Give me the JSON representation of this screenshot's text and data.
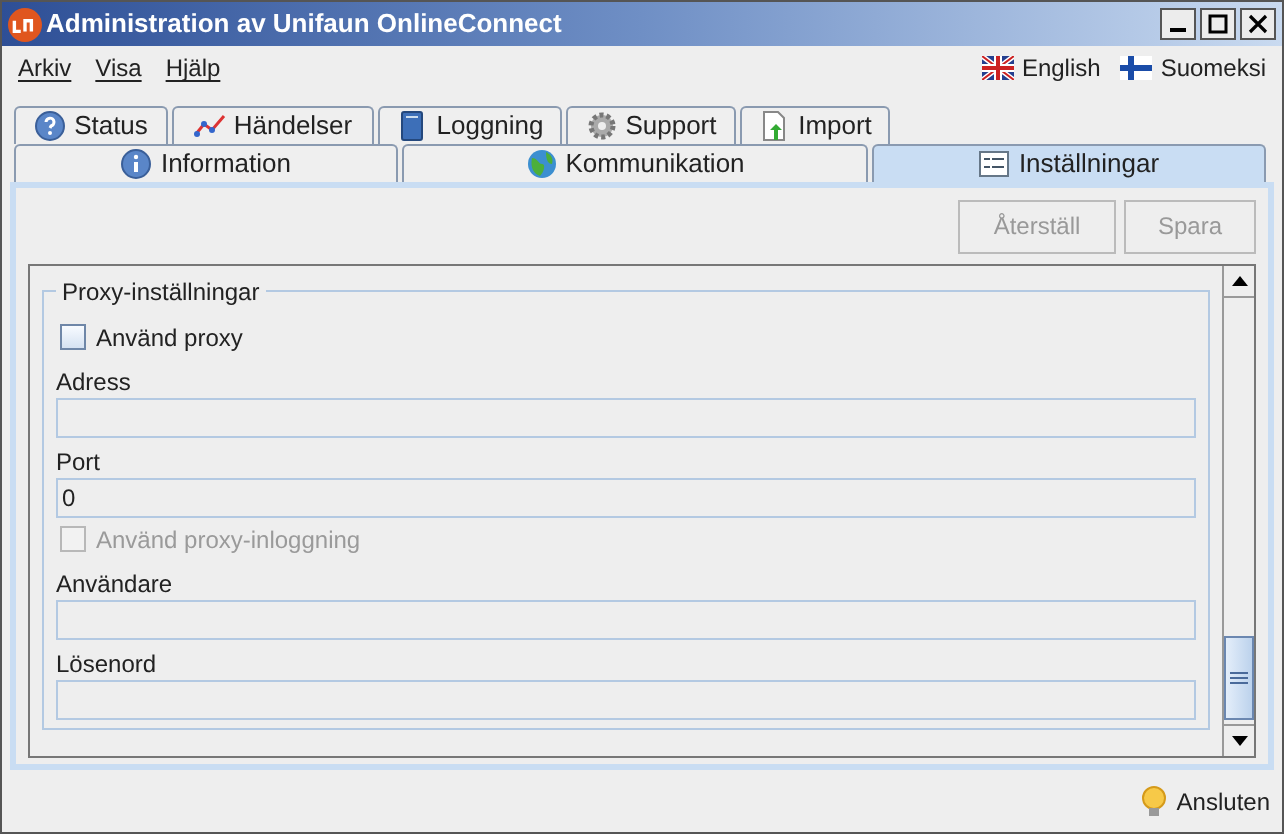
{
  "window": {
    "title": "Administration av Unifaun OnlineConnect"
  },
  "menu": [
    "Arkiv",
    "Visa",
    "Hjälp"
  ],
  "languages": [
    {
      "label": "English",
      "kind": "uk"
    },
    {
      "label": "Suomeksi",
      "kind": "fi"
    }
  ],
  "tabs_row_1": [
    {
      "label": "Status",
      "selected": false
    },
    {
      "label": "Händelser",
      "selected": false
    },
    {
      "label": "Loggning",
      "selected": false
    },
    {
      "label": "Support",
      "selected": false
    },
    {
      "label": "Import",
      "selected": false
    }
  ],
  "tabs_row_2": [
    {
      "label": "Information",
      "selected": false
    },
    {
      "label": "Kommunikation",
      "selected": false
    },
    {
      "label": "Inställningar",
      "selected": true
    }
  ],
  "buttons": [
    {
      "label": "Återställ",
      "disabled": true
    },
    {
      "label": "Spara",
      "disabled": true
    }
  ],
  "group": {
    "title": "Proxy-inställningar",
    "items": [
      {
        "kind": "checkbox",
        "label": "Använd proxy",
        "checked": false,
        "disabled": false
      },
      {
        "kind": "field",
        "label": "Adress"
      },
      {
        "kind": "field",
        "label": "Port",
        "value": "0"
      },
      {
        "kind": "checkbox",
        "label": "Använd proxy-inloggning",
        "checked": false,
        "disabled": true
      },
      {
        "kind": "field",
        "label": "Användare"
      },
      {
        "kind": "field",
        "label": "Lösenord"
      }
    ]
  },
  "status_bar": {
    "text": "Ansluten"
  }
}
